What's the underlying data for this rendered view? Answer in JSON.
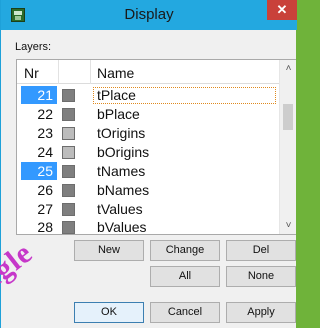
{
  "window": {
    "title": "Display",
    "close_glyph": "✕",
    "icon": "app-icon"
  },
  "layers": {
    "label": "Layers:",
    "columns": {
      "nr": "Nr",
      "name": "Name"
    },
    "rows": [
      {
        "nr": "21",
        "name": "tPlace",
        "color": "#7f7f7f",
        "selected": true,
        "focused": true
      },
      {
        "nr": "22",
        "name": "bPlace",
        "color": "#7f7f7f",
        "selected": false,
        "focused": false
      },
      {
        "nr": "23",
        "name": "tOrigins",
        "color": "#bcbcbc",
        "selected": false,
        "focused": false
      },
      {
        "nr": "24",
        "name": "bOrigins",
        "color": "#bcbcbc",
        "selected": false,
        "focused": false
      },
      {
        "nr": "25",
        "name": "tNames",
        "color": "#7f7f7f",
        "selected": true,
        "focused": false
      },
      {
        "nr": "26",
        "name": "bNames",
        "color": "#7f7f7f",
        "selected": false,
        "focused": false
      },
      {
        "nr": "27",
        "name": "tValues",
        "color": "#7f7f7f",
        "selected": false,
        "focused": false
      },
      {
        "nr": "28",
        "name": "bValues",
        "color": "#7f7f7f",
        "selected": false,
        "focused": false
      }
    ],
    "scroll_up": "˄",
    "scroll_down": "˅"
  },
  "buttons": {
    "new": "New",
    "change": "Change",
    "del": "Del",
    "all": "All",
    "none": "None",
    "ok": "OK",
    "cancel": "Cancel",
    "apply": "Apply"
  },
  "watermark": "eagle",
  "colors": {
    "titlebar": "#23a8e0",
    "selection": "#3399ff",
    "close": "#c9413a"
  }
}
